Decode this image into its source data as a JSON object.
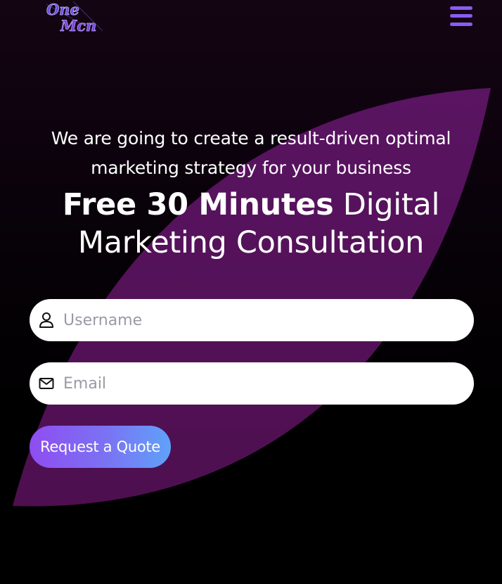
{
  "header": {
    "logo": {
      "line1": "One",
      "line2": "Mcn",
      "icon": "logo-icon"
    },
    "menu": {
      "icon": "hamburger-menu-icon",
      "color": "#8a5cf0"
    }
  },
  "hero": {
    "subtitle_line1": "We are going to create a result-driven optimal",
    "subtitle_line2": "marketing strategy for your business",
    "headline_strong": "Free 30 Minutes",
    "headline_rest_line1": " Digital",
    "headline_line2": "Marketing Consultation"
  },
  "form": {
    "username": {
      "placeholder": "Username",
      "value": "",
      "icon": "user-icon"
    },
    "email": {
      "placeholder": "Email",
      "value": "",
      "icon": "mail-icon"
    },
    "submit_label": "Request a Quote"
  },
  "colors": {
    "background": "#000000",
    "leaf": "#55135a",
    "button_gradient_start": "#8f4df1",
    "button_gradient_end": "#5fa2f8",
    "text": "#ffffff"
  }
}
